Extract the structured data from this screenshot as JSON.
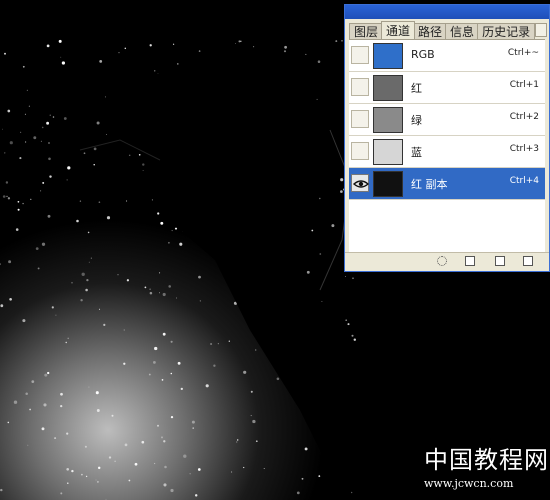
{
  "panel": {
    "tabs": [
      "图层",
      "通道",
      "路径",
      "信息",
      "历史记录"
    ],
    "active_tab": "通道",
    "rows": [
      {
        "label": "RGB",
        "shortcut": "Ctrl+~",
        "visible": false,
        "selected": false,
        "thumb_color": "#2f6fc9"
      },
      {
        "label": "红",
        "shortcut": "Ctrl+1",
        "visible": false,
        "selected": false,
        "thumb_color": "#6a6a6a"
      },
      {
        "label": "绿",
        "shortcut": "Ctrl+2",
        "visible": false,
        "selected": false,
        "thumb_color": "#8a8a8a"
      },
      {
        "label": "蓝",
        "shortcut": "Ctrl+3",
        "visible": false,
        "selected": false,
        "thumb_color": "#d6d6d6"
      },
      {
        "label": "红 副本",
        "shortcut": "Ctrl+4",
        "visible": true,
        "selected": true,
        "thumb_color": "#111111"
      }
    ],
    "bottom_buttons": [
      "load-selection-icon",
      "save-selection-icon",
      "new-channel-icon",
      "delete-channel-icon"
    ]
  },
  "watermark": {
    "title": "中国教程网",
    "url": "www.jcwcn.com"
  },
  "colors": {
    "panel_bg": "#ece9d8",
    "selection": "#316ac5",
    "canvas_bg": "#000000",
    "titlebar": "#2a63d6"
  }
}
